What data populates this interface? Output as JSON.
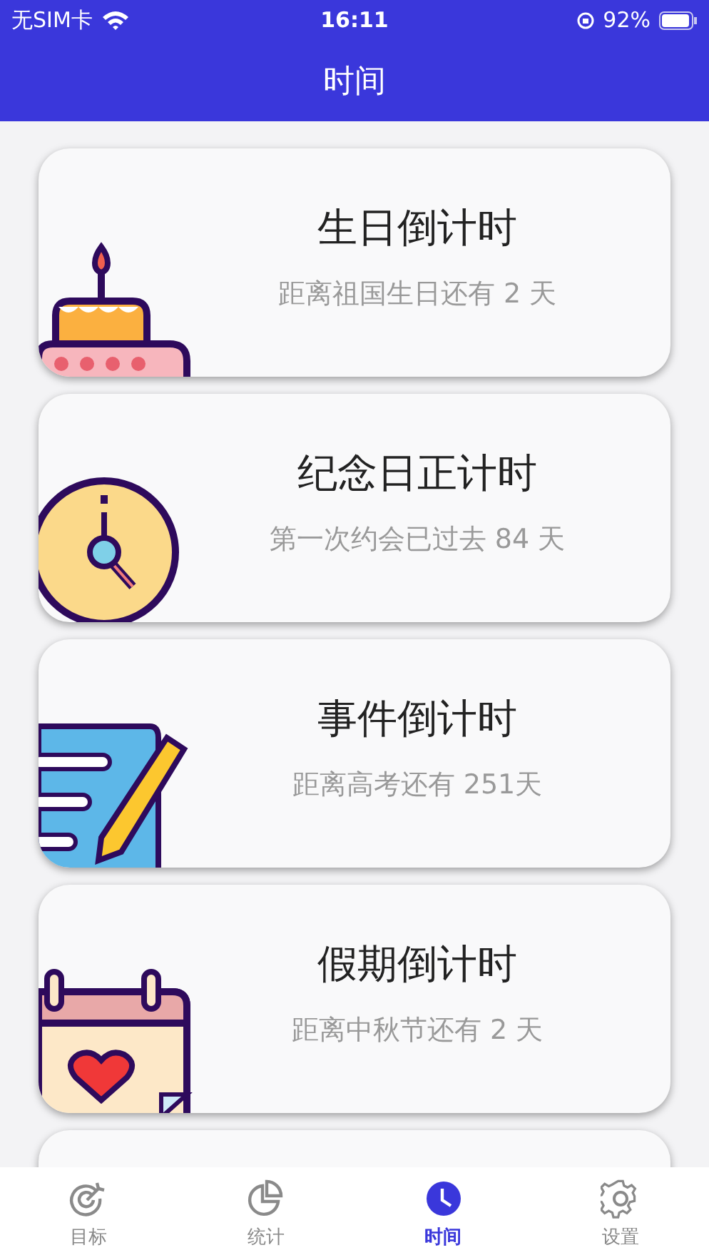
{
  "status_bar": {
    "carrier": "无SIM卡",
    "time": "16:11",
    "battery": "92%"
  },
  "header": {
    "title": "时间"
  },
  "cards": [
    {
      "kind": "cake",
      "title": "生日倒计时",
      "subtitle": "距离祖国生日还有 2 天"
    },
    {
      "kind": "clock",
      "title": "纪念日正计时",
      "subtitle": "第一次约会已过去 84 天"
    },
    {
      "kind": "notes",
      "title": "事件倒计时",
      "subtitle": "距离高考还有 251天"
    },
    {
      "kind": "calendar",
      "title": "假期倒计时",
      "subtitle": "距离中秋节还有 2 天"
    },
    {
      "kind": "blank"
    }
  ],
  "tabs": [
    {
      "kind": "target",
      "label": "目标",
      "selected": false
    },
    {
      "kind": "chart",
      "label": "统计",
      "selected": false
    },
    {
      "kind": "clock",
      "label": "时间",
      "selected": true
    },
    {
      "kind": "gear",
      "label": "设置",
      "selected": false
    }
  ]
}
